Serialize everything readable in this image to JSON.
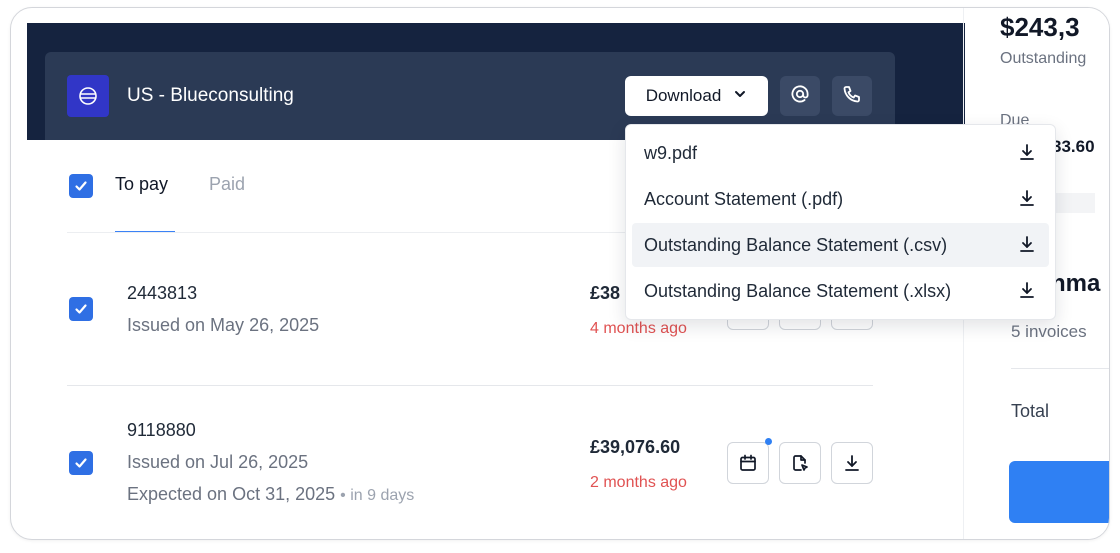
{
  "header": {
    "company_name": "US - Blueconsulting",
    "download_label": "Download"
  },
  "download_menu": {
    "items": [
      {
        "label": "w9.pdf"
      },
      {
        "label": "Account Statement (.pdf)"
      },
      {
        "label": "Outstanding Balance Statement (.csv)"
      },
      {
        "label": "Outstanding Balance Statement (.xlsx)"
      }
    ]
  },
  "tabs": {
    "to_pay": "To pay",
    "paid": "Paid"
  },
  "invoices": [
    {
      "number": "2443813",
      "issued": "Issued on May 26, 2025",
      "amount": "£38",
      "age": "4 months ago"
    },
    {
      "number": "9118880",
      "issued": "Issued on Jul 26, 2025",
      "expected": "Expected on Oct 31, 2025",
      "expected_relative": "in 9 days",
      "amount": "£39,076.60",
      "age": "2 months ago"
    }
  ],
  "summary_panel": {
    "amount": "$243,3",
    "outstanding_label": "Outstanding",
    "due_label": "Due",
    "due_amount": "33.60",
    "summary_heading": "nma",
    "invoice_count": "5 invoices",
    "total_label": "Total"
  },
  "colors": {
    "header_bg": "#15233f",
    "header_bar": "#2b3a55",
    "brand_logo": "#3136c7",
    "accent": "#2f6fe4",
    "danger": "#e05252"
  }
}
